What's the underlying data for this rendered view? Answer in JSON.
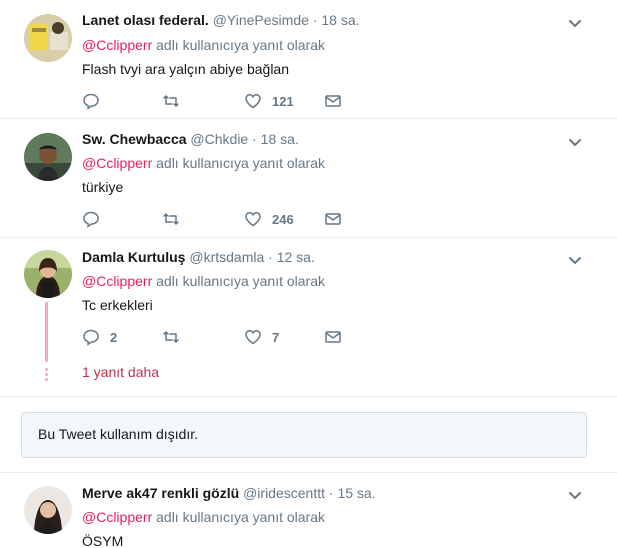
{
  "reply_prefix_suffix": "adlı kullanıcıya yanıt olarak",
  "reply_to": "@Cclipperr",
  "tweets": [
    {
      "name": "Lanet olası federal.",
      "handle": "@YinePesimde",
      "time": "18 sa.",
      "text": "Flash tvyi ara yalçın abiye bağlan",
      "replies": "",
      "retweets": "",
      "likes": "121"
    },
    {
      "name": "Sw. Chewbacca",
      "handle": "@Chkdie",
      "time": "18 sa.",
      "text": "türkiye",
      "replies": "",
      "retweets": "",
      "likes": "246"
    },
    {
      "name": "Damla Kurtuluş",
      "handle": "@krtsdamla",
      "time": "12 sa.",
      "text": "Tc erkekleri",
      "replies": "2",
      "retweets": "",
      "likes": "7"
    },
    {
      "name": "Merve ak47 renkli gözlü",
      "handle": "@iridescenttt",
      "time": "15 sa.",
      "text": "ÖSYM",
      "replies": "",
      "retweets": "",
      "likes": ""
    }
  ],
  "more_replies_label": "1 yanıt daha",
  "unavailable_notice": "Bu Tweet kullanım dışıdır.",
  "separator_dot": "·",
  "colors": {
    "accent_red": "#e0245e",
    "secondary_text": "#657786",
    "divider": "#e6ecf0",
    "thread_line": "#f3aab8"
  }
}
